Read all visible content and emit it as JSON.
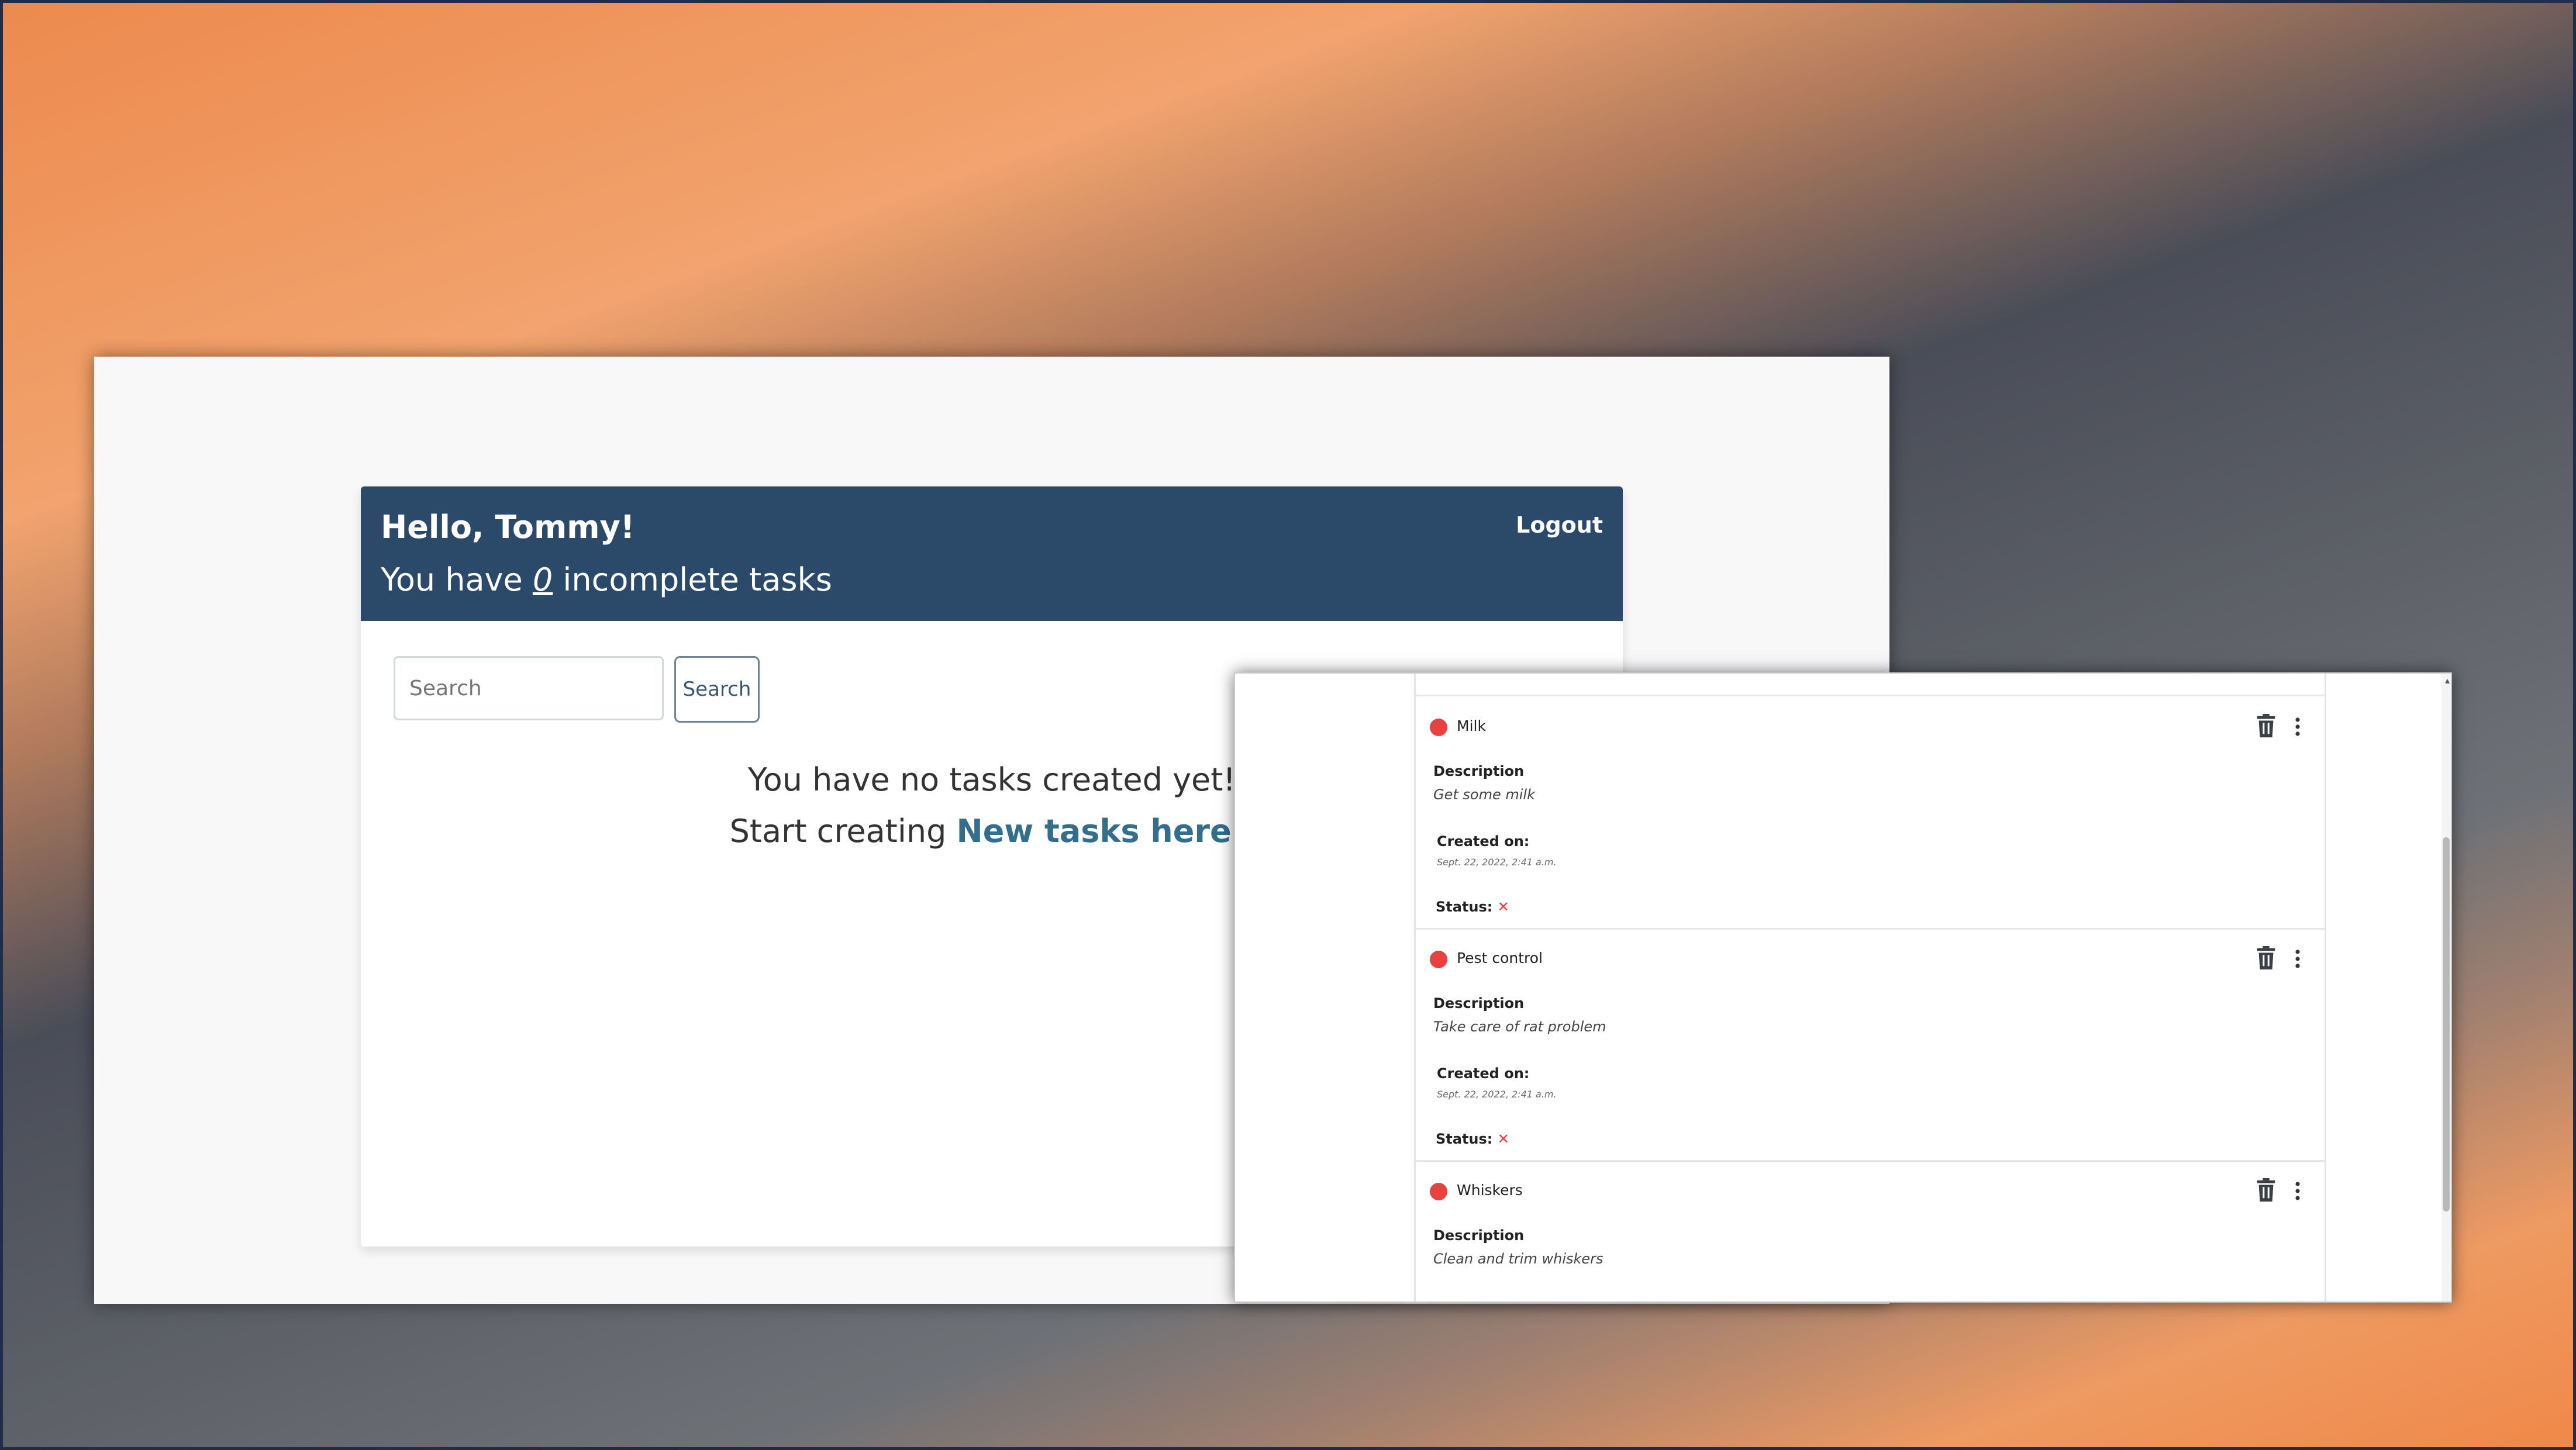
{
  "colors": {
    "header_bg": "#2b4a69",
    "link": "#336e8c",
    "status_dot": "#e94040",
    "status_x": "#e03a3a"
  },
  "main": {
    "greeting": "Hello, Tommy!",
    "incomplete_prefix": "You have ",
    "incomplete_count": "0",
    "incomplete_suffix": " incomplete tasks",
    "logout_label": "Logout",
    "search_placeholder": "Search",
    "search_button": "Search",
    "empty_message": "You have no tasks created yet!",
    "create_prefix": "Start creating ",
    "create_link": "New tasks here",
    "create_suffix": " !"
  },
  "tasks": [
    {
      "title": "Milk",
      "description_label": "Description",
      "description": "Get some milk",
      "created_label": "Created on:",
      "created": "Sept. 22, 2022, 2:41 a.m.",
      "status_label": "Status:",
      "status": "✕"
    },
    {
      "title": "Pest control",
      "description_label": "Description",
      "description": "Take care of rat problem",
      "created_label": "Created on:",
      "created": "Sept. 22, 2022, 2:41 a.m.",
      "status_label": "Status:",
      "status": "✕"
    },
    {
      "title": "Whiskers",
      "description_label": "Description",
      "description": "Clean and trim whiskers"
    }
  ],
  "icons": {
    "delete": "trash-icon",
    "more": "kebab-menu-icon",
    "status": "status-dot-icon"
  }
}
